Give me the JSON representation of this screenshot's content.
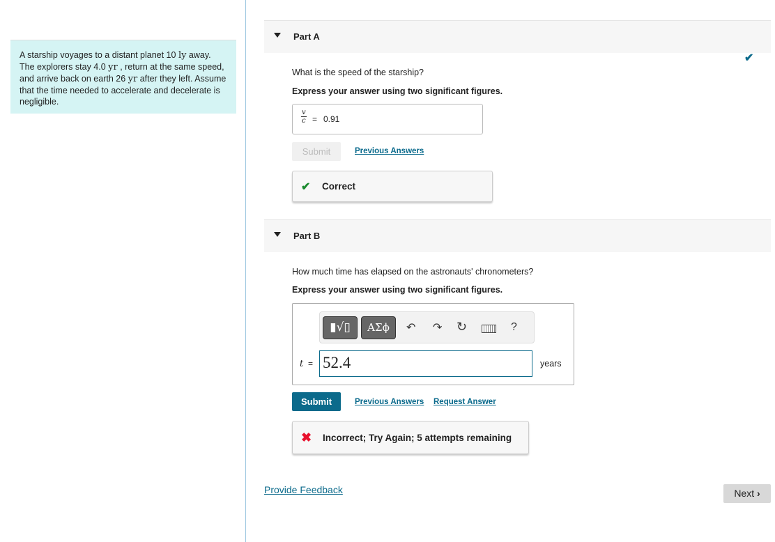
{
  "problem": {
    "t1": "A starship voyages to a distant planet 10 ",
    "u1": "ly",
    "t2": " away. The explorers stay 4.0 ",
    "u2": "yr",
    "t3": " , return at the same speed, and arrive back on earth 26 ",
    "u3": "yr",
    "t4": " after they left. Assume that the time needed to accelerate and decelerate is negligible."
  },
  "partA": {
    "label": "Part A",
    "question": "What is the speed of the starship?",
    "instruction": "Express your answer using two significant figures.",
    "var_num": "v",
    "var_den": "c",
    "equals": "=",
    "answer": "0.91",
    "submit": "Submit",
    "previous": "Previous Answers",
    "feedback": "Correct",
    "status_color": "#1a8a2e"
  },
  "partB": {
    "label": "Part B",
    "question": "How much time has elapsed on the astronauts' chronometers?",
    "instruction": "Express your answer using two significant figures.",
    "toolbar": {
      "templates": "▮√▯",
      "greek": "ΑΣϕ",
      "undo": "undo-icon",
      "redo": "redo-icon",
      "reset": "reset-icon",
      "keyboard": "keyboard-icon",
      "help": "?"
    },
    "var": "t",
    "equals": "=",
    "answer": "52.4",
    "unit": "years",
    "submit": "Submit",
    "previous": "Previous Answers",
    "request": "Request Answer",
    "feedback": "Incorrect; Try Again; 5 attempts remaining",
    "submit_color": "#0b6a8b",
    "error_color": "#e8112d"
  },
  "footer": {
    "feedback_link": "Provide Feedback",
    "next": "Next"
  }
}
